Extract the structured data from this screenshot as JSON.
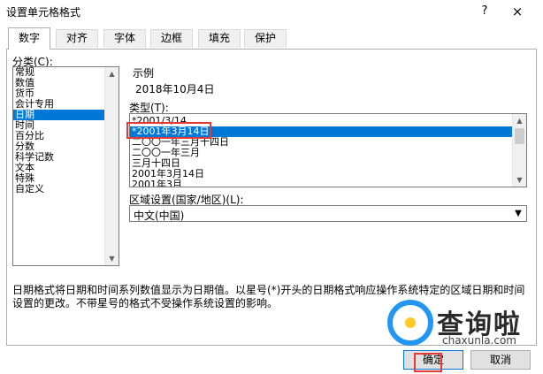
{
  "window": {
    "title": "设置单元格格式",
    "help_label": "?",
    "close_label": "×"
  },
  "tabs": [
    {
      "label": "数字",
      "active": true
    },
    {
      "label": "对齐"
    },
    {
      "label": "字体"
    },
    {
      "label": "边框"
    },
    {
      "label": "填充"
    },
    {
      "label": "保护"
    }
  ],
  "category": {
    "label": "分类(C):",
    "items": [
      "常规",
      "数值",
      "货币",
      "会计专用",
      "日期",
      "时间",
      "百分比",
      "分数",
      "科学记数",
      "文本",
      "特殊",
      "自定义"
    ],
    "selected": "日期"
  },
  "sample": {
    "label": "示例",
    "value": "2018年10月4日"
  },
  "type": {
    "label": "类型(T):",
    "items": [
      "*2001/3/14",
      "*2001年3月14日",
      "二〇〇一年三月十四日",
      "二〇〇一年三月",
      "三月十四日",
      "2001年3月14日",
      "2001年3月"
    ],
    "selected": "*2001年3月14日"
  },
  "locale": {
    "label": "区域设置(国家/地区)(L):",
    "value": "中文(中国)"
  },
  "description": "日期格式将日期和时间系列数值显示为日期值。以星号(*)开头的日期格式响应操作系统特定的区域日期和时间设置的更改。不带星号的格式不受操作系统设置的影响。",
  "buttons": {
    "ok": "确定",
    "cancel": "取消"
  },
  "watermark": {
    "cn": "查询啦",
    "en": "chaxunla.com"
  },
  "colors": {
    "selection": "#0078d7",
    "highlight": "#e53935",
    "watermark_blue": "#2196f3"
  }
}
